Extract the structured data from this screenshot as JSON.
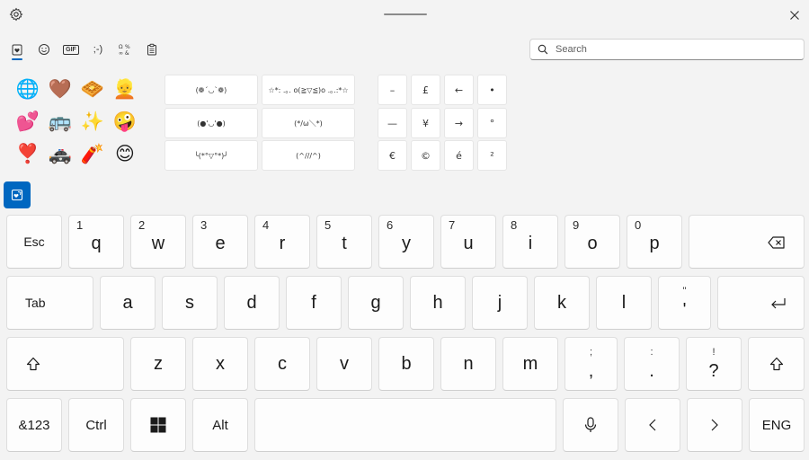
{
  "search": {
    "placeholder": "Search"
  },
  "emojis": [
    "🌐",
    "🤎",
    "🧇",
    "👱",
    "💕",
    "🚌",
    "✨",
    "🤪",
    "❣️",
    "🚓",
    "🧨",
    "😊"
  ],
  "kaomoji": [
    "(❁´◡`❁)",
    "☆*: .｡. o(≧▽≦)o .｡.:*☆",
    "(●'◡'●)",
    "(*/ω＼*)",
    "╰(*°▽°*)╯",
    "(^///^)"
  ],
  "symbols": [
    "–",
    "£",
    "←",
    "•",
    "—",
    "¥",
    "→",
    "°",
    "€",
    "©",
    "é",
    "²"
  ],
  "tabs": [
    {
      "name": "tab-favorites",
      "icon": "heart-clipboard-icon"
    },
    {
      "name": "tab-emoji",
      "icon": "smiley-icon"
    },
    {
      "name": "tab-gif",
      "label": "GIF"
    },
    {
      "name": "tab-kaomoji",
      "label": ";-)"
    },
    {
      "name": "tab-symbols",
      "icon": "symbols-icon"
    },
    {
      "name": "tab-clipboard",
      "icon": "clipboard-icon"
    }
  ],
  "keyboard": {
    "row1": [
      {
        "label": "Esc"
      },
      {
        "label": "q",
        "num": "1"
      },
      {
        "label": "w",
        "num": "2"
      },
      {
        "label": "e",
        "num": "3"
      },
      {
        "label": "r",
        "num": "4"
      },
      {
        "label": "t",
        "num": "5"
      },
      {
        "label": "y",
        "num": "6"
      },
      {
        "label": "u",
        "num": "7"
      },
      {
        "label": "i",
        "num": "8"
      },
      {
        "label": "o",
        "num": "9"
      },
      {
        "label": "p",
        "num": "0"
      }
    ],
    "row2": [
      {
        "label": "Tab"
      },
      {
        "label": "a"
      },
      {
        "label": "s"
      },
      {
        "label": "d"
      },
      {
        "label": "f"
      },
      {
        "label": "g"
      },
      {
        "label": "h"
      },
      {
        "label": "j"
      },
      {
        "label": "k"
      },
      {
        "label": "l"
      },
      {
        "label": "'",
        "alt": "\""
      }
    ],
    "row3": [
      {
        "label": "z"
      },
      {
        "label": "x"
      },
      {
        "label": "c"
      },
      {
        "label": "v"
      },
      {
        "label": "b"
      },
      {
        "label": "n"
      },
      {
        "label": "m"
      },
      {
        "label": ",",
        "alt": ";"
      },
      {
        "label": ".",
        "alt": ":"
      },
      {
        "label": "?",
        "alt": "!"
      }
    ],
    "row4": [
      {
        "label": "&123"
      },
      {
        "label": "Ctrl"
      },
      {
        "label": "Alt"
      },
      {
        "label": "ENG"
      }
    ]
  }
}
